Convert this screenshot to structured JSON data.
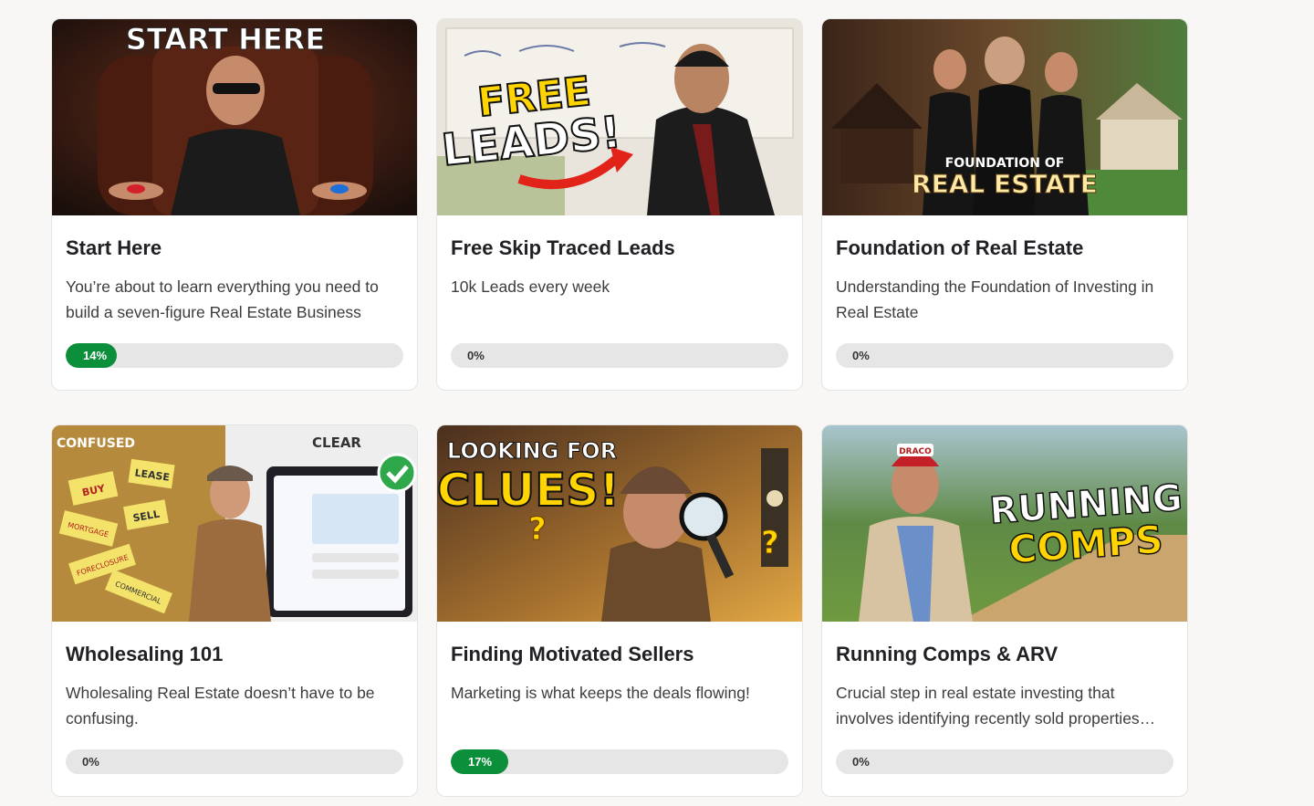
{
  "courses": [
    {
      "title": "Start Here",
      "description": "You’re about to learn everything you need to build a seven-figure Real Estate Business",
      "progress_label": "14%",
      "progress": 14,
      "thumbnail_text": [
        "START HERE"
      ]
    },
    {
      "title": "Free Skip Traced Leads",
      "description": "10k Leads every week",
      "progress_label": "0%",
      "progress": 0,
      "thumbnail_text": [
        "FREE",
        "LEADS!"
      ]
    },
    {
      "title": "Foundation of Real Estate",
      "description": "Understanding the Foundation of Investing in Real Estate",
      "progress_label": "0%",
      "progress": 0,
      "thumbnail_text": [
        "FOUNDATION OF",
        "REAL ESTATE"
      ]
    },
    {
      "title": "Wholesaling 101",
      "description": "Wholesaling Real Estate doesn’t have to be confusing.",
      "progress_label": "0%",
      "progress": 0,
      "thumbnail_text": [
        "CONFUSED",
        "CLEAR",
        "BUY",
        "LEASE",
        "SELL",
        "MORTGAGE",
        "FORECLOSURE",
        "COMMERCIAL"
      ]
    },
    {
      "title": "Finding Motivated Sellers",
      "description": "Marketing is what keeps the deals flowing!",
      "progress_label": "17%",
      "progress": 17,
      "thumbnail_text": [
        "LOOKING FOR",
        "CLUES!"
      ]
    },
    {
      "title": "Running Comps & ARV",
      "description": "Crucial step in real estate investing that involves identifying recently sold properties…",
      "progress_label": "0%",
      "progress": 0,
      "thumbnail_text": [
        "RUNNING",
        "COMPS",
        "DRACO"
      ]
    }
  ],
  "colors": {
    "progress_fill": "#0c8f3a",
    "progress_track": "#e6e6e6",
    "page_background": "#f8f7f5"
  }
}
